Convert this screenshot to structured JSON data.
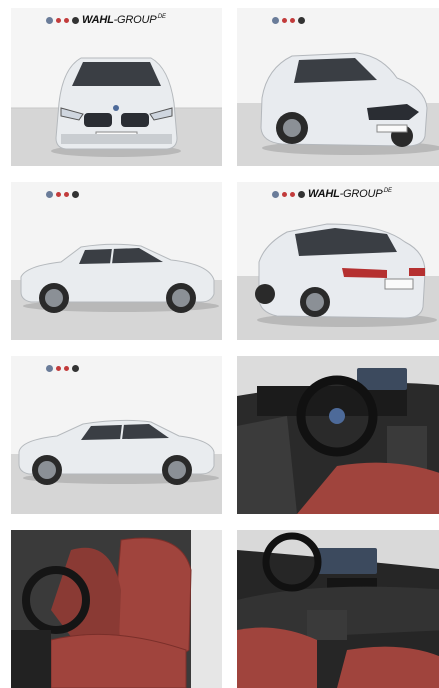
{
  "dealer": {
    "brand_main": "WAHL",
    "brand_suffix": "-GROUP",
    "brand_tld": ".DE"
  },
  "gallery": {
    "photos": [
      {
        "view": "front"
      },
      {
        "view": "front-three-quarter"
      },
      {
        "view": "side-right"
      },
      {
        "view": "rear-three-quarter"
      },
      {
        "view": "side-left"
      },
      {
        "view": "interior-cockpit"
      },
      {
        "view": "interior-seat"
      },
      {
        "view": "interior-dashboard"
      }
    ]
  },
  "colors": {
    "car_body": "#e8ebee",
    "showroom_wall": "#f4f4f4",
    "showroom_floor": "#d8d8d8",
    "upholstery": "#a0443d",
    "interior_trim": "#2a2a2a"
  }
}
